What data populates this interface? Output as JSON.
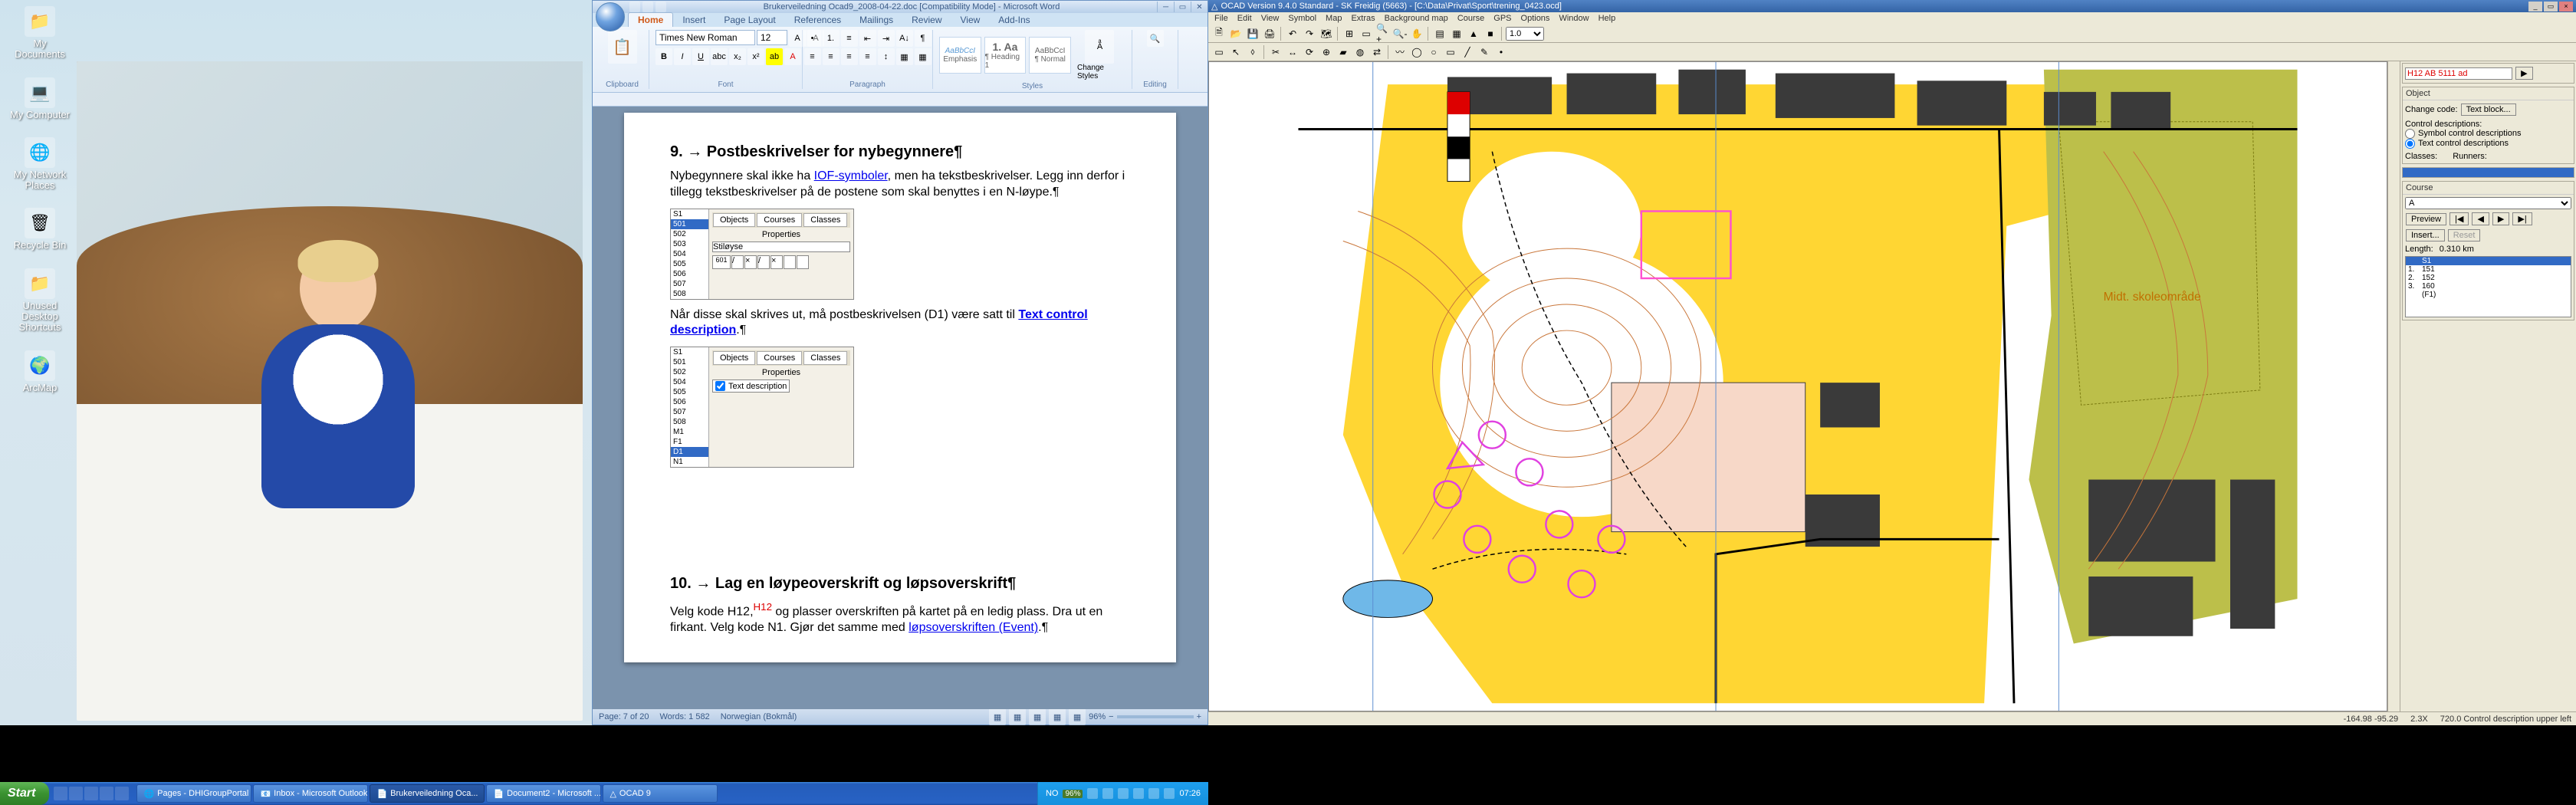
{
  "desktop": {
    "icons": [
      {
        "label": "My Documents",
        "glyph": "📁"
      },
      {
        "label": "My Computer",
        "glyph": "💻"
      },
      {
        "label": "My Network Places",
        "glyph": "🌐"
      },
      {
        "label": "Recycle Bin",
        "glyph": "🗑"
      },
      {
        "label": "Unused Desktop Shortcuts",
        "glyph": "📁"
      },
      {
        "label": "ArcMap",
        "glyph": "🌍"
      }
    ]
  },
  "word": {
    "title": "Brukerveiledning Ocad9_2008-04-22.doc [Compatibility Mode] - Microsoft Word",
    "tabs": [
      "Home",
      "Insert",
      "Page Layout",
      "References",
      "Mailings",
      "Review",
      "View",
      "Add-Ins"
    ],
    "active_tab": "Home",
    "font_name": "Times New Roman",
    "font_size": "12",
    "groups": {
      "clipboard": "Clipboard",
      "font": "Font",
      "paragraph": "Paragraph",
      "styles": "Styles",
      "editing": "Editing"
    },
    "style_gallery": [
      {
        "sample": "AaBbCcI",
        "name": "Emphasis"
      },
      {
        "sample": "1. Aa",
        "name": "¶ Heading 1"
      },
      {
        "sample": "AaBbCcI",
        "name": "¶ Normal"
      }
    ],
    "change_styles": "Change Styles",
    "doc": {
      "h9": "9. → Postbeskrivelser for nybegynnere¶",
      "p9a": "Nybegynnere skal ikke ha ",
      "p9a_link": "IOF-symboler",
      "p9a2": ", men ha tekstbeskrivelser. Legg inn derfor i tillegg tekstbeskrivelser på de postene som skal benyttes i en N-løype.¶",
      "panel1_tabs": [
        "Objects",
        "Courses",
        "Classes"
      ],
      "panel1_sub": "Properties",
      "panel1_list": [
        "S1",
        "501",
        "502",
        "503",
        "504",
        "505",
        "506",
        "507",
        "508"
      ],
      "panel1_sel": "501",
      "panel1_field": "Stiløyse",
      "panel1_code": "601",
      "p9b_pre": "Når disse skal skrives ut, må postbeskrivelsen (D1) være satt til ",
      "p9b_link": "Text control description",
      "p9b_post": ".¶",
      "panel2_list": [
        "S1",
        "501",
        "502",
        "504",
        "505",
        "506",
        "507",
        "508",
        "M1",
        "F1",
        "D1",
        "N1"
      ],
      "panel2_sel": "D1",
      "panel2_check": "Text description",
      "h10": "10. → Lag en løypeoverskrift og løpsoverskrift¶",
      "p10a_pre": "Velg kode H12,",
      "p10a_sup": "H12",
      "p10a_mid": " og plasser overskriften på kartet på en ledig plass. Dra ut en firkant. Velg kode N1. Gjør det samme med ",
      "p10a_link": "løpsoverskriften (Event)",
      "p10a_post": ".¶"
    },
    "status": {
      "page": "Page: 7 of 20",
      "words": "Words: 1 582",
      "lang": "Norwegian (Bokmål)",
      "zoom": "96%"
    }
  },
  "ocad": {
    "title": "OCAD Version 9.4.0 Standard - SK Freidig (5663) - [C:\\Data\\Privat\\Sport\\trening_0423.ocd]",
    "menu": [
      "File",
      "Edit",
      "View",
      "Symbol",
      "Map",
      "Extras",
      "Background map",
      "Course",
      "GPS",
      "Options",
      "Window",
      "Help"
    ],
    "symbol_input": "H12 AB 5111 ad",
    "right": {
      "object_h": "Object",
      "change_code": "Change code:",
      "text_block": "Text block...",
      "cd_h": "Control descriptions:",
      "cd_opt1": "Symbol control descriptions",
      "cd_opt2": "Text control descriptions",
      "classes": "Classes:",
      "runners": "Runners:",
      "course_h": "Course",
      "course_sel": "A",
      "preview": "Preview",
      "insert": "Insert...",
      "reset": "Reset",
      "length_lbl": "Length:",
      "length_val": "0.310 km",
      "list": [
        "S1",
        "151",
        "152",
        "160",
        "(F1)"
      ],
      "list_sel": "S1",
      "list_nums": [
        "1.",
        "2.",
        "3."
      ]
    },
    "status": {
      "coords": "-164.98 -95.29",
      "scale": "2.3X",
      "sym": "720.0 Control description upper left"
    },
    "map_label": "Midt. skoleområde"
  },
  "taskbar": {
    "start": "Start",
    "tasks": [
      {
        "label": "Pages - DHIGroupPortal ...",
        "active": false
      },
      {
        "label": "Inbox - Microsoft Outlook",
        "active": false
      },
      {
        "label": "Brukerveiledning Oca...",
        "active": true
      },
      {
        "label": "Document2 - Microsoft ...",
        "active": false
      },
      {
        "label": "OCAD 9",
        "active": false
      }
    ],
    "tray_pct": "96%",
    "lang": "NO",
    "time": "07:26"
  }
}
